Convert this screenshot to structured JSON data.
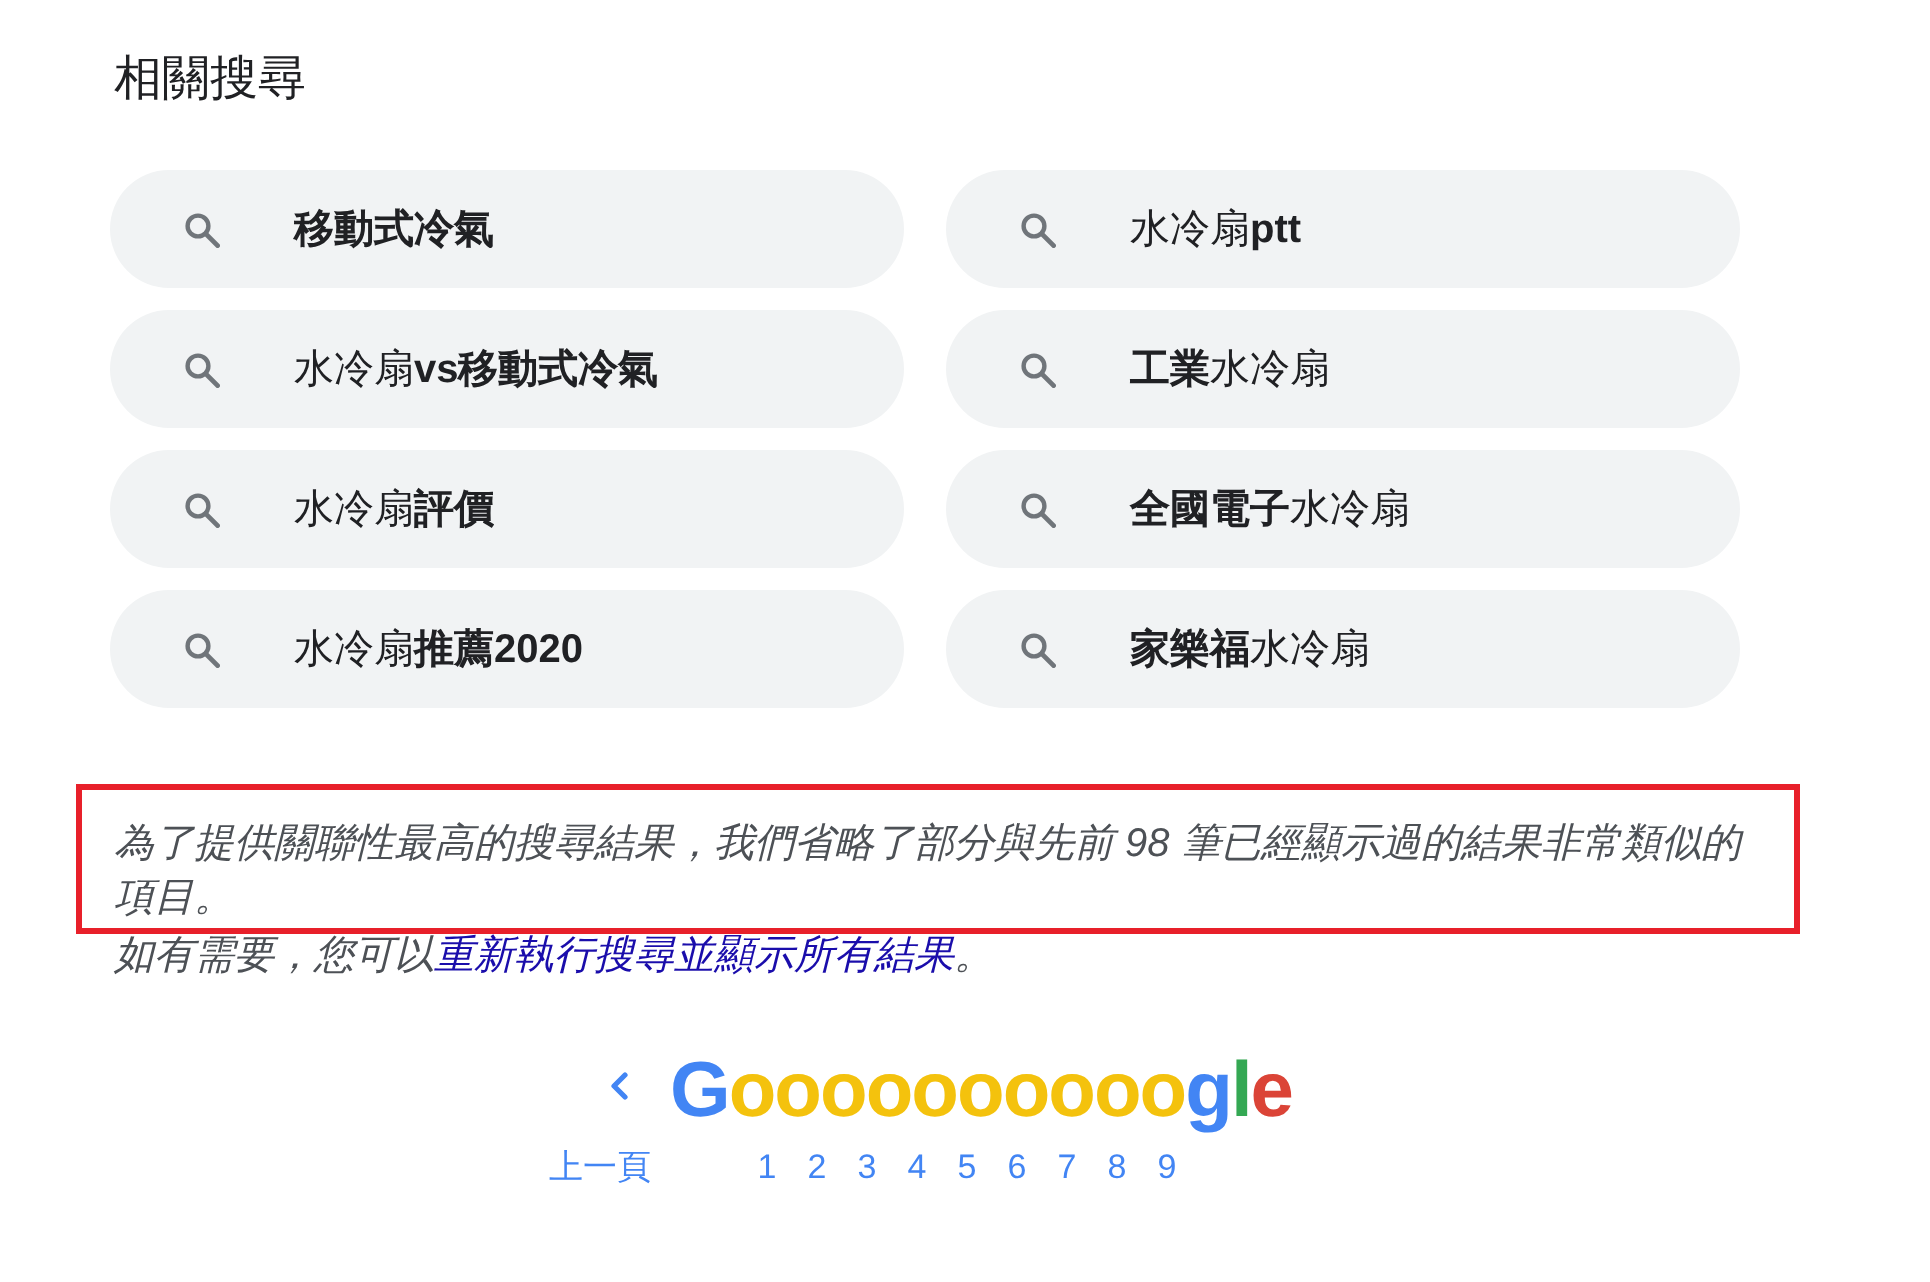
{
  "related_searches": {
    "title": "相關搜尋",
    "items": [
      {
        "text": "**移動式冷氣**"
      },
      {
        "text": "水冷扇**ptt**"
      },
      {
        "text": "水冷扇**vs移動式冷氣**"
      },
      {
        "text": "**工業**水冷扇"
      },
      {
        "text": "水冷扇**評價**"
      },
      {
        "text": "**全國電子**水冷扇"
      },
      {
        "text": "水冷扇**推薦2020**"
      },
      {
        "text": "**家樂福**水冷扇"
      }
    ]
  },
  "omitted_notice": {
    "highlighted": true,
    "text": "為了提供關聯性最高的搜尋結果，我們省略了部分與先前 98 筆已經顯示過的結果非常類似的項目。",
    "repeat": {
      "before": "如有需要，您可以",
      "link": "重新執行搜尋並顯示所有結果",
      "after": "。"
    }
  },
  "pagination": {
    "previous": "上一頁",
    "logo": "Goooooooooogle",
    "pages": [
      {
        "label": "1"
      },
      {
        "label": "2"
      },
      {
        "label": "3"
      },
      {
        "label": "4"
      },
      {
        "label": "5"
      },
      {
        "label": "6"
      },
      {
        "label": "7"
      },
      {
        "label": "8"
      },
      {
        "label": "9"
      }
    ]
  }
}
